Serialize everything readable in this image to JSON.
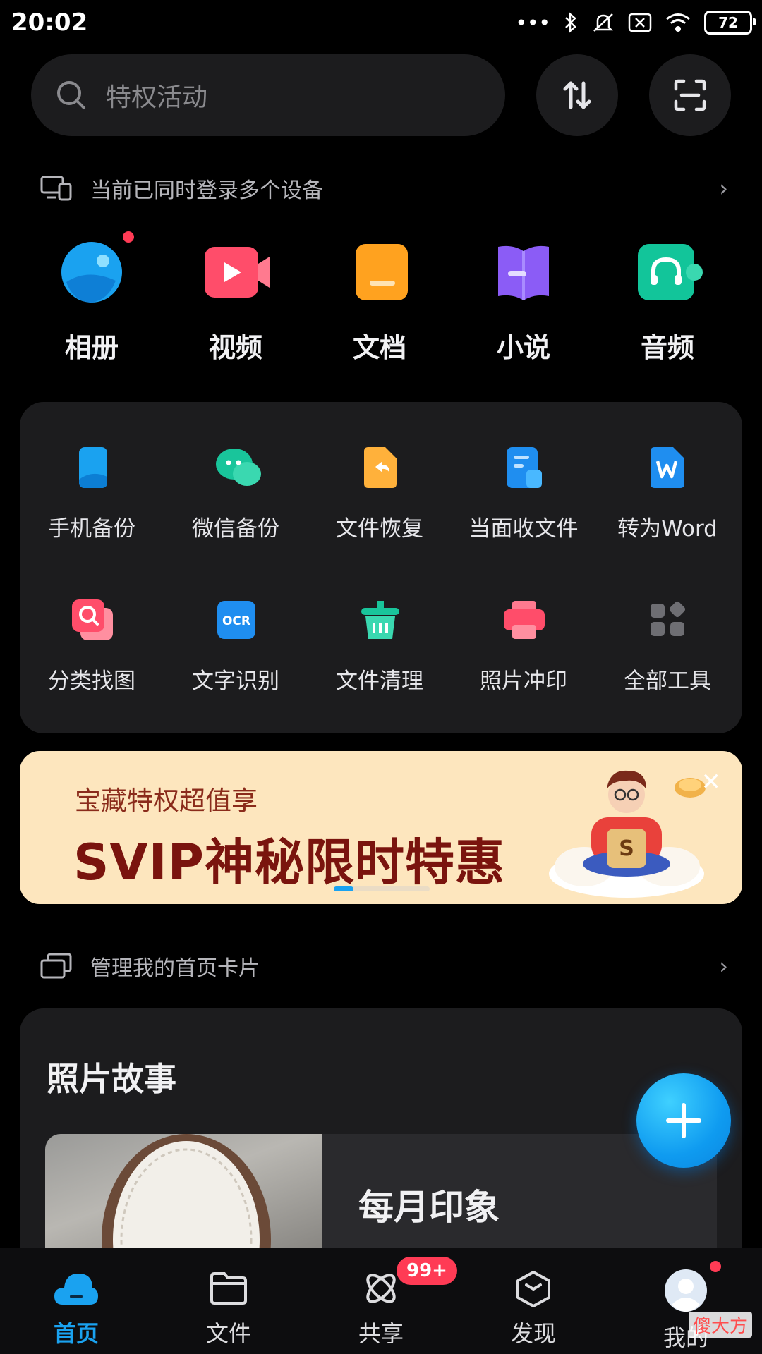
{
  "status_bar": {
    "time": "20:02",
    "battery": "72",
    "icons": [
      "more-dots-icon",
      "bluetooth-icon",
      "mute-bell-icon",
      "x-box-icon",
      "wifi-icon",
      "battery-icon"
    ]
  },
  "search": {
    "placeholder": "特权活动",
    "transfer_icon": "transfer-arrows-icon",
    "scan_icon": "scan-icon"
  },
  "device_notice": {
    "text": "当前已同时登录多个设备"
  },
  "categories": [
    {
      "label": "相册",
      "icon": "album-icon",
      "color": "#1aa2f0",
      "has_dot": true
    },
    {
      "label": "视频",
      "icon": "video-icon",
      "color": "#ff4d6a"
    },
    {
      "label": "文档",
      "icon": "document-icon",
      "color": "#ffa21f"
    },
    {
      "label": "小说",
      "icon": "novel-icon",
      "color": "#8b5cf6"
    },
    {
      "label": "音频",
      "icon": "audio-icon",
      "color": "#12c59a"
    }
  ],
  "tools": [
    {
      "label": "手机备份",
      "icon": "phone-backup-icon"
    },
    {
      "label": "微信备份",
      "icon": "wechat-backup-icon"
    },
    {
      "label": "文件恢复",
      "icon": "file-restore-icon"
    },
    {
      "label": "当面收文件",
      "icon": "receive-file-icon"
    },
    {
      "label": "转为Word",
      "icon": "word-convert-icon"
    },
    {
      "label": "分类找图",
      "icon": "image-search-icon"
    },
    {
      "label": "文字识别",
      "icon": "ocr-icon",
      "icon_text": "OCR"
    },
    {
      "label": "文件清理",
      "icon": "file-clean-icon"
    },
    {
      "label": "照片冲印",
      "icon": "photo-print-icon"
    },
    {
      "label": "全部工具",
      "icon": "all-tools-icon"
    }
  ],
  "banner": {
    "subtitle": "宝藏特权超值享",
    "title": "SVIP神秘限时特惠",
    "emblem": "S",
    "bg_color": "#fde6be"
  },
  "manage_cards": {
    "text": "管理我的首页卡片"
  },
  "photo_story": {
    "title": "照片故事",
    "item_label": "每月印象"
  },
  "bottom_nav": [
    {
      "label": "首页",
      "icon": "home-cloud-icon",
      "active": true
    },
    {
      "label": "文件",
      "icon": "folder-icon"
    },
    {
      "label": "共享",
      "icon": "share-icon",
      "badge": "99+"
    },
    {
      "label": "发现",
      "icon": "discover-icon"
    },
    {
      "label": "我的",
      "icon": "avatar-icon",
      "has_dot": true
    }
  ],
  "watermark": "傻大方",
  "accent": "#1aa2f0"
}
